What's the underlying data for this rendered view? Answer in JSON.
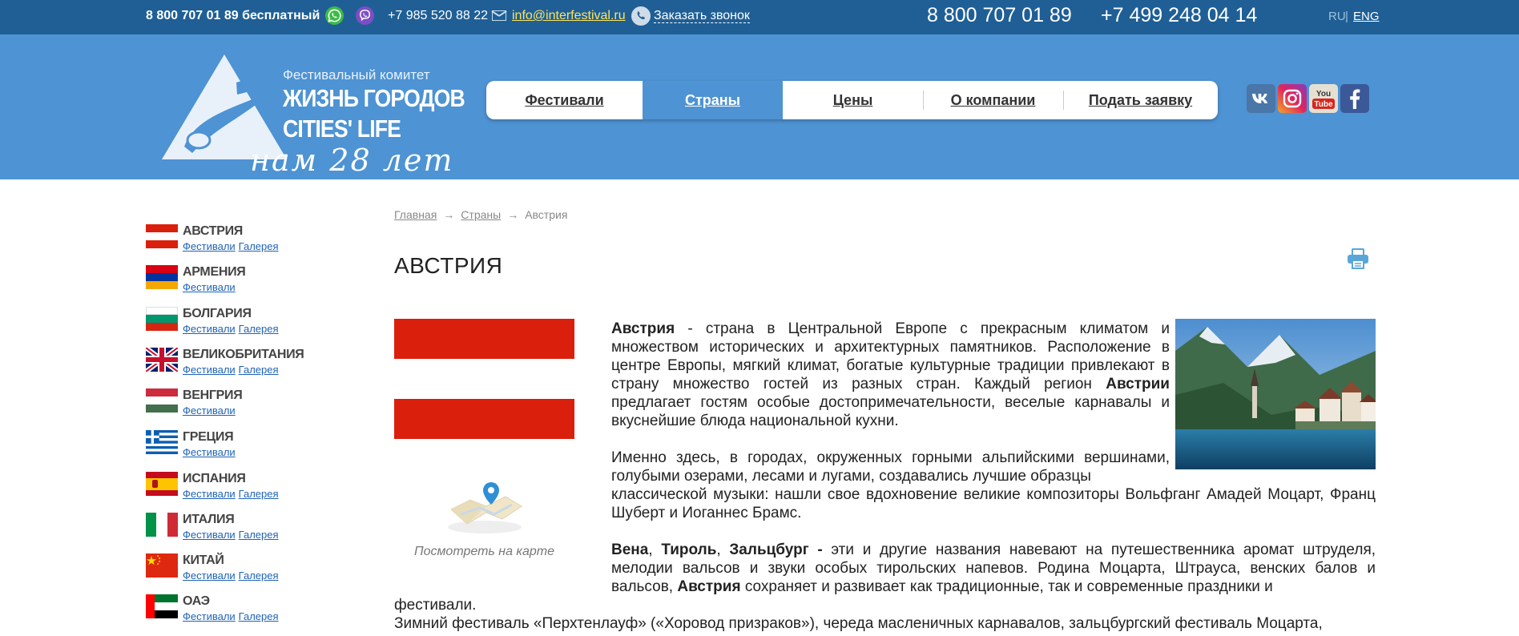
{
  "topbar": {
    "phone_free": "8 800 707 01 89 бесплатный",
    "phone_mobile": "+7 985 520 88 22",
    "email": "info@interfestival.ru",
    "callback": "Заказать звонок",
    "big_phone_1": "8 800 707 01 89",
    "big_phone_2": "+7 499 248 04 14",
    "lang_ru": "RU",
    "lang_sep": "|",
    "lang_eng": "ENG"
  },
  "logo": {
    "subtitle": "Фестивальный комитет",
    "line1": "ЖИЗНЬ ГОРОДОВ",
    "line2": "CITIES' LIFE",
    "line3": "нам 28 лет"
  },
  "nav": {
    "items": [
      {
        "label": "Фестивали"
      },
      {
        "label": "Страны"
      },
      {
        "label": "Цены"
      },
      {
        "label": "О компании"
      },
      {
        "label": "Подать заявку"
      }
    ]
  },
  "social": {
    "icons": [
      "vk-icon",
      "instagram-icon",
      "youtube-icon",
      "facebook-icon"
    ],
    "youtube_you": "You",
    "youtube_tube": "Tube"
  },
  "sidebar": {
    "countries": [
      {
        "name": "АВСТРИЯ",
        "festivals": "Фестивали",
        "gallery": "Галерея"
      },
      {
        "name": "АРМЕНИЯ",
        "festivals": "Фестивали",
        "gallery": ""
      },
      {
        "name": "БОЛГАРИЯ",
        "festivals": "Фестивали",
        "gallery": "Галерея"
      },
      {
        "name": "ВЕЛИКОБРИТАНИЯ",
        "festivals": "Фестивали",
        "gallery": "Галерея"
      },
      {
        "name": "ВЕНГРИЯ",
        "festivals": "Фестивали",
        "gallery": ""
      },
      {
        "name": "ГРЕЦИЯ",
        "festivals": "Фестивали",
        "gallery": ""
      },
      {
        "name": "ИСПАНИЯ",
        "festivals": "Фестивали",
        "gallery": "Галерея"
      },
      {
        "name": "ИТАЛИЯ",
        "festivals": "Фестивали",
        "gallery": "Галерея"
      },
      {
        "name": "КИТАЙ",
        "festivals": "Фестивали",
        "gallery": "Галерея"
      },
      {
        "name": "ОАЭ",
        "festivals": "Фестивали",
        "gallery": "Галерея"
      }
    ]
  },
  "breadcrumb": {
    "home": "Главная",
    "countries": "Страны",
    "current": "Австрия",
    "arrow": "→"
  },
  "page": {
    "title": "АВСТРИЯ",
    "map_caption": "Посмотреть на карте"
  },
  "article": {
    "p1_b1": "Австрия",
    "p1_t1": " - страна в Центральной Европе с прекрасным климатом и множеством исторических и архитектурных памятников. Расположение в центре Европы, мягкий климат, богатые  культурные традиции привлекают в страну множество гостей из разных стран. Каждый регион ",
    "p1_b2": "Австрии",
    "p1_t2": " предлагает гостям особые достопримечательности, веселые карнавалы и вкуснейшие блюда национальной кухни.",
    "p2a": "Именно здесь, в городах, окруженных горными альпийскими вершинами, голубыми озерами, лесами и лугами, создавались лучшие образцы",
    "p2b": "классической музыки: нашли свое вдохновение великие композиторы Вольфганг Амадей Моцарт, Франц Шуберт и Иоганнес Брамс.",
    "p3_b1": "Вена",
    "p3_c1": ", ",
    "p3_b2": "Тироль",
    "p3_c2": ", ",
    "p3_b3": "Зальцбург -",
    "p3_t1": " эти и другие названия навевают на путешественника аромат штруделя, мелодии вальсов и звуки особых тирольских напевов. Родина Моцарта, Штрауса, венских балов и вальсов, ",
    "p3_b4": "Австрия",
    "p3_t2": " сохраняет и развивает как традиционные, так и современные праздники и",
    "p3_last": "фестивали.",
    "p4": "Зимний фестиваль «Перхтенлауф» («Хоровод призраков»), череда масленичных карнавалов, зальцбургский фестиваль Моцарта,"
  },
  "colors": {
    "topbar": "#1f5f96",
    "header": "#4e93d3",
    "accent_email": "#ffe35c",
    "link": "#1f63b6",
    "austria_red": "#da1f0c"
  }
}
